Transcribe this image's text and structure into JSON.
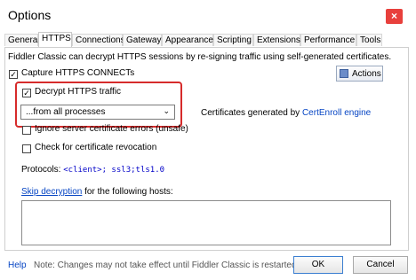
{
  "window": {
    "title": "Options",
    "close_glyph": "×"
  },
  "tabs": [
    {
      "label": "General"
    },
    {
      "label": "HTTPS"
    },
    {
      "label": "Connections"
    },
    {
      "label": "Gateway"
    },
    {
      "label": "Appearance"
    },
    {
      "label": "Scripting"
    },
    {
      "label": "Extensions"
    },
    {
      "label": "Performance"
    },
    {
      "label": "Tools"
    }
  ],
  "https": {
    "description": "Fiddler Classic can decrypt HTTPS sessions by re-signing traffic using self-generated certificates.",
    "actions_label": "Actions",
    "capture_label": "Capture HTTPS CONNECTs",
    "capture_checked": true,
    "decrypt_label": "Decrypt HTTPS traffic",
    "decrypt_checked": true,
    "process_filter_value": "...from all processes",
    "cert_text": "Certificates generated by",
    "cert_link": "CertEnroll engine",
    "ignore_errors_label": "Ignore server certificate errors (unsafe)",
    "ignore_errors_checked": false,
    "revocation_label": "Check for certificate revocation",
    "revocation_checked": false,
    "protocols_label": "Protocols:",
    "protocols_value": "<client>; ssl3;tls1.0",
    "skip_link": "Skip decryption",
    "skip_text": "for the following hosts:",
    "hosts_value": ""
  },
  "footer": {
    "help_label": "Help",
    "note": "Note: Changes may not take effect until Fiddler Classic is restarted.",
    "ok_label": "OK",
    "cancel_label": "Cancel"
  },
  "colors": {
    "highlight_box": "#d62b2b",
    "link": "#0645c4",
    "close_button": "#e8403c"
  },
  "icons": {
    "close": "close-icon",
    "actions": "actions-icon",
    "dropdown": "chevron-down-icon",
    "check": "checkmark-icon"
  }
}
